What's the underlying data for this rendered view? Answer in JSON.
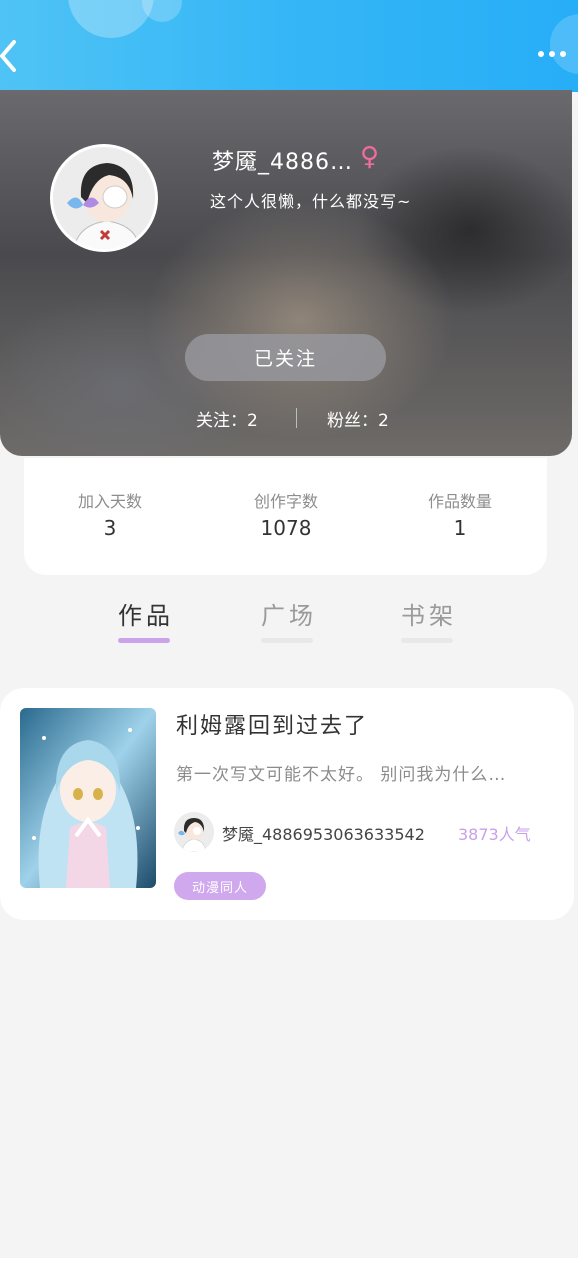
{
  "topbar": {
    "back_icon": "chevron-left-icon",
    "more_icon": "more-horizontal-icon",
    "accent": "#35b6f6"
  },
  "profile": {
    "username": "梦魇_4886…",
    "gender_symbol": "♀",
    "bio": "这个人很懒，什么都没写~",
    "follow_button": "已关注",
    "following_label": "关注：2",
    "followers_label": "粉丝：2"
  },
  "stats": [
    {
      "label": "加入天数",
      "value": "3"
    },
    {
      "label": "创作字数",
      "value": "1078"
    },
    {
      "label": "作品数量",
      "value": "1"
    }
  ],
  "tabs": [
    {
      "label": "作品",
      "active": true
    },
    {
      "label": "广场",
      "active": false
    },
    {
      "label": "书架",
      "active": false
    }
  ],
  "works": [
    {
      "title": "利姆露回到过去了",
      "description": "第一次写文可能不太好。 别问我为什么…",
      "author": "梦魇_4886953063633542",
      "popularity": "3873人气",
      "tag": "动漫同人"
    }
  ],
  "colors": {
    "tab_indicator": "#c9a4ea",
    "tag_bg": "#cfa8ee",
    "popularity": "#c9a0ea",
    "gender": "#f06c9b"
  }
}
